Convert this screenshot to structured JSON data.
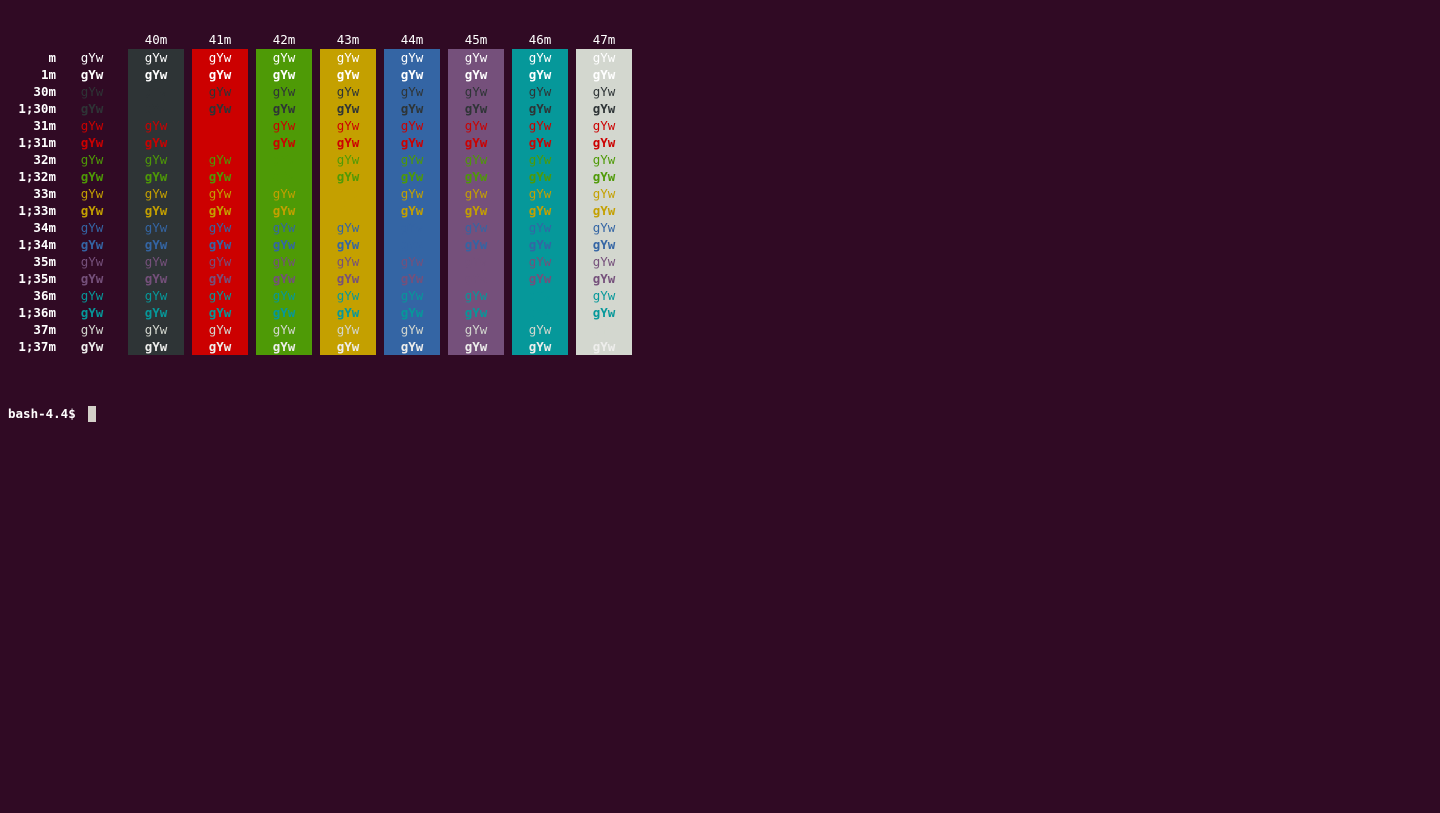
{
  "terminal": {
    "background": "#300a24",
    "foreground": "#ffffff",
    "prompt": "bash-4.4$ ",
    "sample_text": "gYw",
    "bg_headers": [
      "40m",
      "41m",
      "42m",
      "43m",
      "44m",
      "45m",
      "46m",
      "47m"
    ],
    "bg_colors": [
      "#2e3436",
      "#cc0000",
      "#4e9a06",
      "#c4a000",
      "#3465a4",
      "#75507b",
      "#06989a",
      "#d3d7cf"
    ],
    "rows": [
      {
        "label": "m",
        "fg": "#ffffff",
        "bold": false
      },
      {
        "label": "1m",
        "fg": "#ffffff",
        "bold": true
      },
      {
        "label": "30m",
        "fg": "#2e3436",
        "bold": false
      },
      {
        "label": "1;30m",
        "fg": "#2e3436",
        "bold": true
      },
      {
        "label": "31m",
        "fg": "#cc0000",
        "bold": false
      },
      {
        "label": "1;31m",
        "fg": "#cc0000",
        "bold": true
      },
      {
        "label": "32m",
        "fg": "#4e9a06",
        "bold": false
      },
      {
        "label": "1;32m",
        "fg": "#4e9a06",
        "bold": true
      },
      {
        "label": "33m",
        "fg": "#c4a000",
        "bold": false
      },
      {
        "label": "1;33m",
        "fg": "#c4a000",
        "bold": true
      },
      {
        "label": "34m",
        "fg": "#3465a4",
        "bold": false
      },
      {
        "label": "1;34m",
        "fg": "#3465a4",
        "bold": true
      },
      {
        "label": "35m",
        "fg": "#75507b",
        "bold": false
      },
      {
        "label": "1;35m",
        "fg": "#75507b",
        "bold": true
      },
      {
        "label": "36m",
        "fg": "#06989a",
        "bold": false
      },
      {
        "label": "1;36m",
        "fg": "#06989a",
        "bold": true
      },
      {
        "label": "37m",
        "fg": "#d3d7cf",
        "bold": false
      },
      {
        "label": "1;37m",
        "fg": "#eeeeec",
        "bold": true
      }
    ]
  }
}
